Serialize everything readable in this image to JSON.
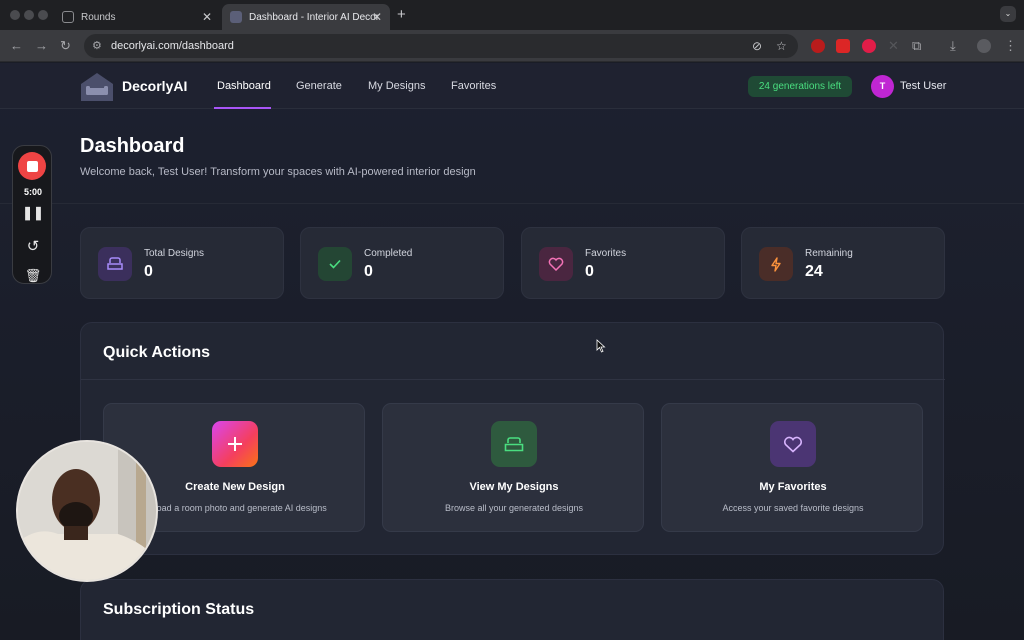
{
  "browser": {
    "tabs": [
      {
        "title": "Rounds",
        "active": false
      },
      {
        "title": "Dashboard - Interior AI Decor",
        "active": true
      }
    ],
    "url": "decorlyai.com/dashboard"
  },
  "app": {
    "brand": "DecorlyAI",
    "nav": [
      {
        "label": "Dashboard",
        "active": true
      },
      {
        "label": "Generate",
        "active": false
      },
      {
        "label": "My Designs",
        "active": false
      },
      {
        "label": "Favorites",
        "active": false
      }
    ],
    "generations_badge": "24 generations left",
    "user": {
      "initial": "T",
      "name": "Test User"
    }
  },
  "page": {
    "title": "Dashboard",
    "welcome": "Welcome back, Test User! Transform your spaces with AI-powered interior design"
  },
  "stats": [
    {
      "label": "Total Designs",
      "value": "0",
      "icon": "sofa-icon",
      "color": "#8b5cf6"
    },
    {
      "label": "Completed",
      "value": "0",
      "icon": "check-icon",
      "color": "#22c55e"
    },
    {
      "label": "Favorites",
      "value": "0",
      "icon": "heart-icon",
      "color": "#ec4899"
    },
    {
      "label": "Remaining",
      "value": "24",
      "icon": "bolt-icon",
      "color": "#f97316"
    }
  ],
  "quick_actions": {
    "title": "Quick Actions",
    "items": [
      {
        "title": "Create New Design",
        "desc": "Upload a room photo and generate AI designs",
        "icon": "plus-icon"
      },
      {
        "title": "View My Designs",
        "desc": "Browse all your generated designs",
        "icon": "sofa-icon"
      },
      {
        "title": "My Favorites",
        "desc": "Access your saved favorite designs",
        "icon": "heart-icon"
      }
    ]
  },
  "subscription": {
    "title": "Subscription Status"
  },
  "recorder": {
    "time": "5:00"
  },
  "colors": {
    "accent": "#a855f7",
    "badge_green": "#4ade80",
    "record_red": "#ef4444"
  }
}
